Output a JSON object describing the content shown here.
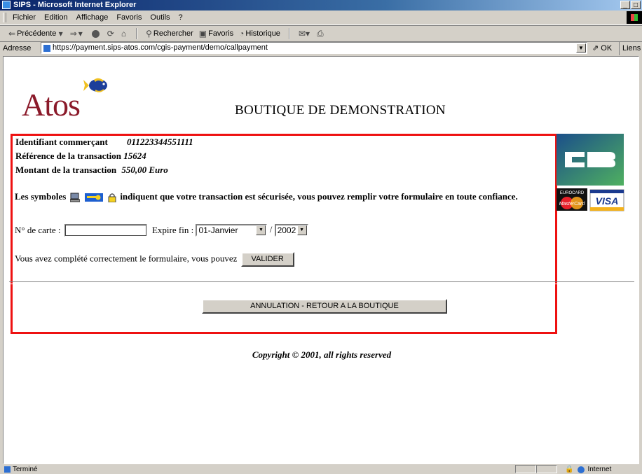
{
  "window": {
    "title": "SIPS - Microsoft Internet Explorer",
    "buttons": [
      "_",
      "□"
    ]
  },
  "menu": [
    "Fichier",
    "Edition",
    "Affichage",
    "Favoris",
    "Outils",
    "?"
  ],
  "toolbar": {
    "back": "Précédente",
    "search": "Rechercher",
    "favorites": "Favoris",
    "history": "Historique"
  },
  "address": {
    "label": "Adresse",
    "url": "https://payment.sips-atos.com/cgis-payment/demo/callpayment",
    "go": "OK",
    "links": "Liens"
  },
  "page": {
    "logo": "Atos",
    "title": "BOUTIQUE DE DEMONSTRATION",
    "merchant_label": "Identifiant commerçant",
    "merchant_value": "011223344551111",
    "reference_label": "Référence de la transaction",
    "reference_value": "15624",
    "amount_label": "Montant de la transaction",
    "amount_value": "550,00 Euro",
    "secure_before": "Les symboles",
    "secure_after": "indiquent que votre transaction est sécurisée, vous pouvez remplir votre formulaire en toute confiance.",
    "card_label": "N° de carte :",
    "card_value": "",
    "expiry_label": "Expire fin :",
    "month": "01-Janvier",
    "slash": "/",
    "year": "2002",
    "validate_text": "Vous avez complété correctement le formulaire, vous pouvez",
    "validate_button": "VALIDER",
    "cancel_button": "ANNULATION - RETOUR A LA BOUTIQUE",
    "copyright": "Copyright © 2001, all rights reserved",
    "cards": {
      "cb": "CB",
      "eurocard": "EUROCARD",
      "mastercard": "MasterCard",
      "visa": "VISA"
    }
  },
  "status": {
    "text": "Terminé",
    "zone": "Internet"
  },
  "colors": {
    "highlight_box": "#ee1111",
    "logo": "#8b1a2a",
    "titlebar": "#0a246a"
  }
}
